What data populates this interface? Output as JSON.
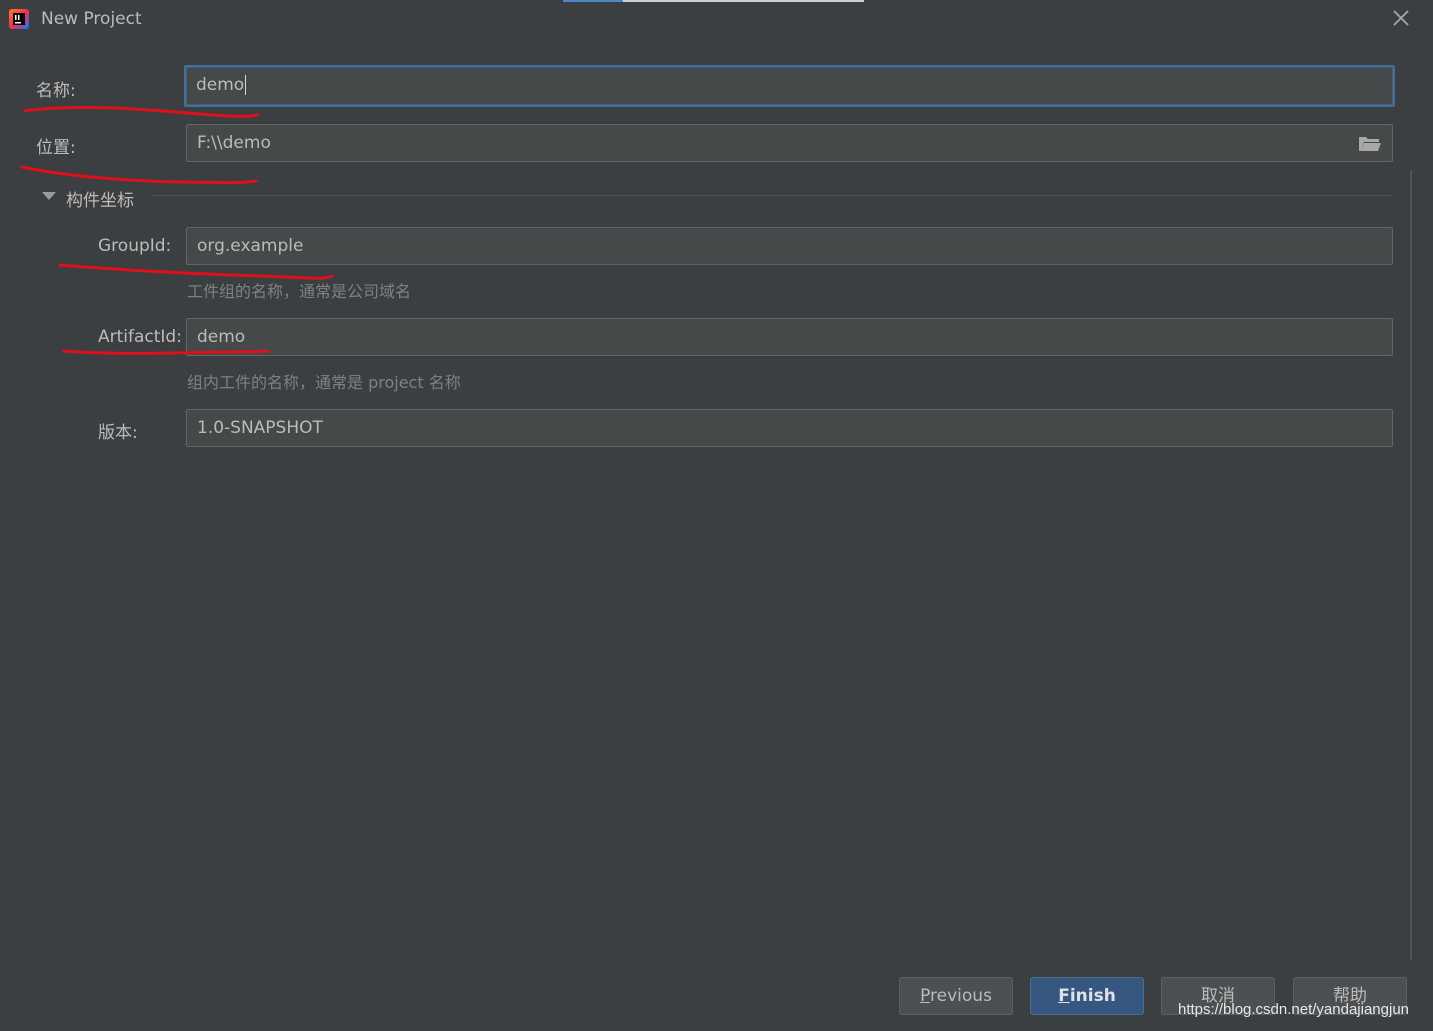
{
  "window": {
    "title": "New Project"
  },
  "form": {
    "name": {
      "label": "名称:",
      "value": "demo"
    },
    "location": {
      "label": "位置:",
      "value": "F:\\\\demo"
    },
    "artifact_section": {
      "title": "构件坐标",
      "group_id": {
        "label": "GroupId:",
        "value": "org.example",
        "hint": "工件组的名称，通常是公司域名"
      },
      "artifact_id": {
        "label": "ArtifactId:",
        "value": "demo",
        "hint": "组内工件的名称，通常是 project 名称"
      },
      "version": {
        "label": "版本:",
        "value": "1.0-SNAPSHOT"
      }
    }
  },
  "buttons": {
    "previous_mnemonic": "P",
    "previous_rest": "revious",
    "finish_mnemonic": "F",
    "finish_rest": "inish",
    "cancel": "取消",
    "help": "帮助"
  },
  "watermark": "https://blog.csdn.net/yandajiangjun",
  "icons": [
    "intellij-icon",
    "close-icon",
    "folder-icon",
    "collapse-triangle-icon"
  ],
  "colors": {
    "background": "#3c3f41",
    "field": "#45494a",
    "focus": "#466d94",
    "primary": "#365880",
    "annotation": "#e0101a"
  }
}
